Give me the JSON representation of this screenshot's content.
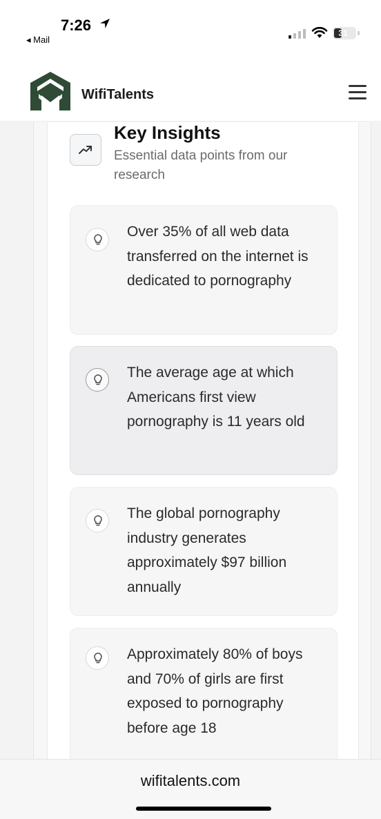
{
  "status_bar": {
    "time": "7:26",
    "back_label": "◂ Mail",
    "battery": "31"
  },
  "header": {
    "brand": "WifiTalents"
  },
  "key_insights": {
    "title": "Key Insights",
    "subtitle": "Essential data points from our research",
    "items": [
      {
        "text": "Over 35% of all web data transferred on the internet is dedicated to pornography"
      },
      {
        "text": "The average age at which Americans first view pornography is 11 years old"
      },
      {
        "text": "The global pornography industry generates approximately $97 billion annually"
      },
      {
        "text": "Approximately 80% of boys and 70% of girls are first exposed to pornography before age 18"
      }
    ]
  },
  "url_bar": {
    "url": "wifitalents.com"
  },
  "colors": {
    "brand_green": "#2f4a35",
    "card_bg": "#f6f6f7",
    "active_card_bg": "#eeeef0"
  },
  "icons": [
    "location-arrow-icon",
    "signal-icon",
    "wifi-icon",
    "battery-icon",
    "logo-icon",
    "hamburger-menu-icon",
    "trend-up-icon",
    "lightbulb-icon"
  ]
}
